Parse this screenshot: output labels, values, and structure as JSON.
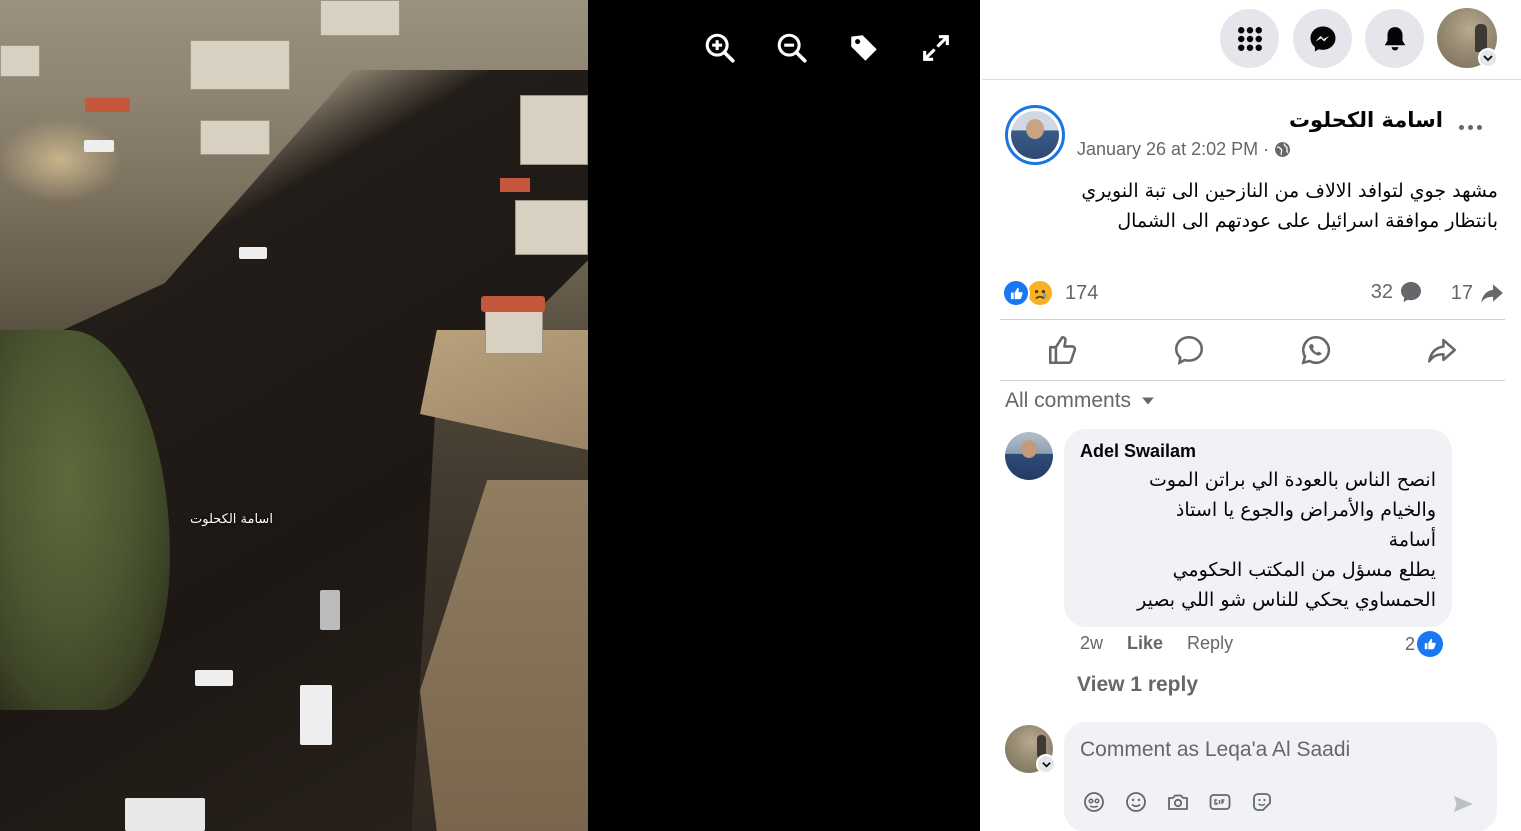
{
  "photo": {
    "watermark": "اسامة الكحلوت"
  },
  "viewer_tools": {
    "zoom_in": "zoom-in-icon",
    "zoom_out": "zoom-out-icon",
    "tag": "tag-icon",
    "fullscreen": "fullscreen-icon"
  },
  "topbar": {
    "icons": [
      "menu-grid-icon",
      "messenger-icon",
      "bell-icon"
    ]
  },
  "post": {
    "author": "اسامة الكحلوت",
    "timestamp": "January 26 at 2:02 PM",
    "separator": "·",
    "text_line1": "مشهد جوي لتوافد الالاف من النازحين الى تبة النويري",
    "text_line2": "بانتظار موافقة اسرائيل على عودتهم الى الشمال",
    "reaction_count": "174",
    "comment_count": "32",
    "share_count": "17"
  },
  "comments_filter": {
    "label": "All comments"
  },
  "comment": {
    "author": "Adel Swailam",
    "line1": "انصح الناس بالعودة الي براتن الموت",
    "line2": "والخيام والأمراض والجوع يا استاذ",
    "line3": "أسامة",
    "line4": "يطلع مسؤل من المكتب الحكومي",
    "line5": "الحمساوي يحكي للناس شو اللي بصير",
    "age": "2w",
    "like_label": "Like",
    "reply_label": "Reply",
    "like_count": "2",
    "view_replies": "View 1 reply"
  },
  "composer": {
    "placeholder": "Comment as Leqa'a Al Saadi",
    "value": ""
  },
  "colors": {
    "accent": "#1877f2",
    "secondary_text": "#65676b",
    "bubble_bg": "#f0f2f5",
    "button_bg": "#e4e6eb"
  }
}
